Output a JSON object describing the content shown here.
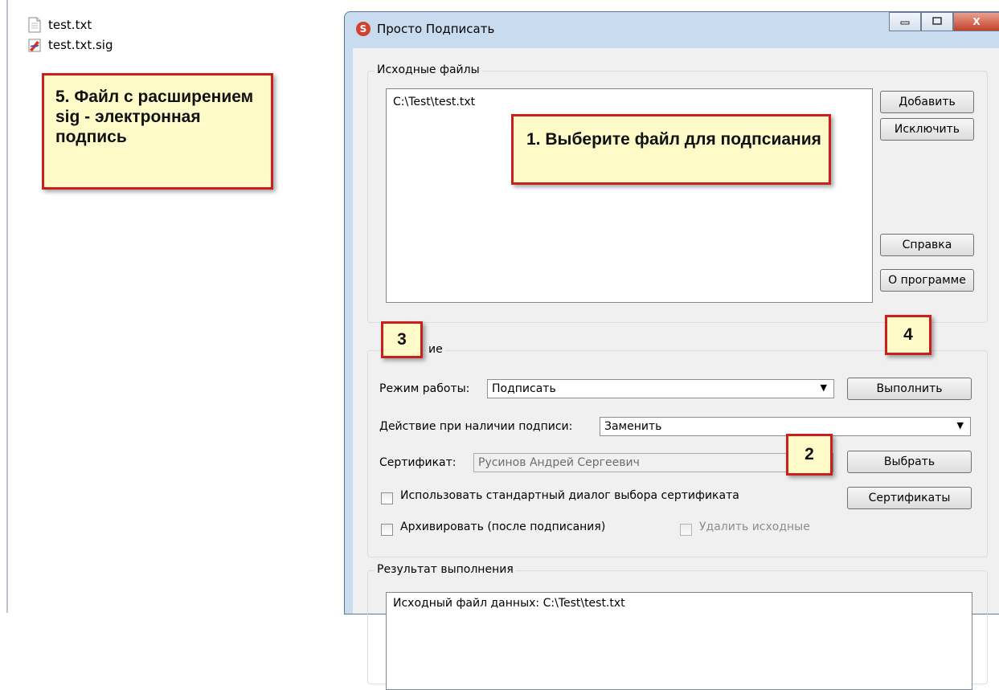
{
  "explorer": {
    "files": [
      {
        "name": "test.txt",
        "icon": "text-file-icon"
      },
      {
        "name": "test.txt.sig",
        "icon": "signature-file-icon"
      }
    ]
  },
  "annotations": {
    "note5": "5. Файл с расширением sig - электронная подпись",
    "note1": "1. Выберите файл для подпсиания",
    "note3": "3",
    "note4": "4",
    "note2": "2"
  },
  "window": {
    "title": "Просто Подписать",
    "app_icon": "S",
    "controls": {
      "minimize": "minimize-icon",
      "maximize": "maximize-icon",
      "close": "X"
    }
  },
  "source_files": {
    "legend": "Исходные файлы",
    "items": [
      "C:\\Test\\test.txt"
    ],
    "buttons": {
      "add": "Добавить",
      "exclude": "Исключить",
      "help": "Справка",
      "about": "О программе"
    }
  },
  "action": {
    "legend_partial": "ие",
    "mode_label": "Режим работы:",
    "mode_value": "Подписать",
    "execute": "Выполнить",
    "on_signature_label": "Действие при наличии подписи:",
    "on_signature_value": "Заменить",
    "cert_label": "Сертификат:",
    "cert_value": "Русинов Андрей Сергеевич",
    "choose": "Выбрать",
    "use_std_dialog": "Использовать стандартный диалог выбора сертификата",
    "certificates": "Сертификаты",
    "archive": "Архивировать (после подписания)",
    "delete_source": "Удалить исходные"
  },
  "result": {
    "legend": "Результат выполнения",
    "line1": "Исходный файл данных: C:\\Test\\test.txt"
  },
  "colors": {
    "note_bg": "#fffbc8",
    "note_border": "#c8201c",
    "window_frame": "#c9dbee"
  }
}
